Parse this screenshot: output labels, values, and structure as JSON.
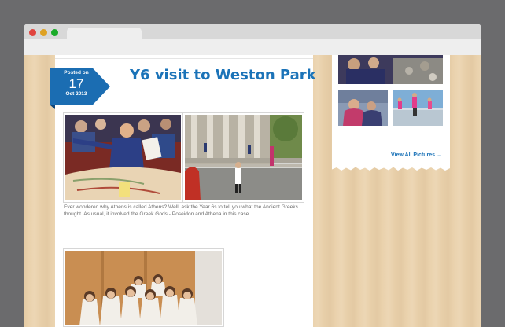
{
  "post": {
    "posted_label": "Posted on",
    "day": "17",
    "month_year": "Oct 2013",
    "title": "Y6 visit to Weston Park",
    "excerpt": "Ever wondered why Athens is called Athens? Well, ask the Year 6s to tell you what the Ancient Greeks thought. As usual, it involved the Greek Gods - Poseidon and Athena in this case."
  },
  "sidebar": {
    "view_all_label": "View All Pictures →"
  },
  "colors": {
    "accent_blue": "#1b73b8",
    "ribbon_blue": "#1b6db2",
    "wood": "#ebd3ae",
    "browser_chrome": "#d8d8d8"
  }
}
